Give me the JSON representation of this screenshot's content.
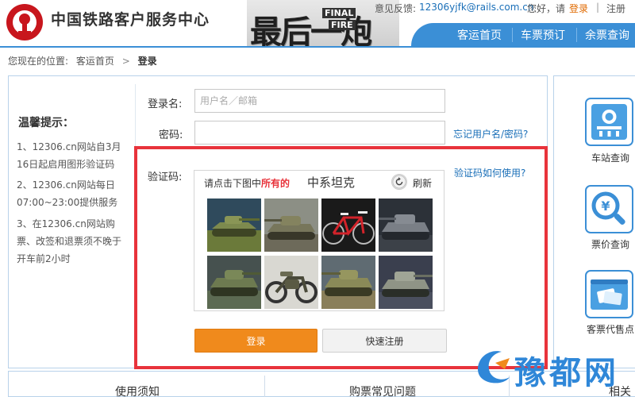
{
  "header": {
    "site_title": "中国铁路客户服务中心",
    "banner_title": "最后一炮",
    "banner_sub1": "FINAL",
    "banner_sub2": "FIRE",
    "feedback_label": "意见反馈:",
    "feedback_email": "12306yjfk@rails.com.cn",
    "greeting": "您好，请",
    "login_link": "登录",
    "separator": "|",
    "register_link": "注册",
    "nav": [
      "客运首页",
      "车票预订",
      "余票查询"
    ],
    "brand_color": "#3b8fd6"
  },
  "breadcrumb": {
    "prefix": "您现在的位置:",
    "home": "客运首页",
    "arrow": ">",
    "current": "登录"
  },
  "tips": {
    "title": "温馨提示：",
    "items": [
      "1、12306.cn网站自3月16日起启用图形验证码",
      "2、12306.cn网站每日07:00~23:00提供服务",
      "3、在12306.cn网站购票、改签和退票须不晚于开车前2小时"
    ]
  },
  "form": {
    "username_label": "登录名:",
    "username_placeholder": "用户名／邮箱",
    "password_label": "密码:",
    "forgot_link": "忘记用户名/密码?",
    "captcha_label": "验证码:",
    "captcha_help_link": "验证码如何使用?",
    "captcha_prompt_prefix": "请点击下图中",
    "captcha_prompt_emph": "所有的",
    "captcha_target": "中系坦克",
    "refresh_label": "刷新",
    "captcha_images": [
      "tank-image",
      "tank-image",
      "bicycle-image",
      "tank-image",
      "tank-image",
      "motorcycle-image",
      "tank-image",
      "tank-image"
    ],
    "login_button": "登录",
    "quick_register_button": "快速注册",
    "highlight_color": "#e8333b",
    "login_button_color": "#f08a1c"
  },
  "right_sidebar": {
    "items": [
      {
        "label": "车站查询",
        "icon": "station-icon"
      },
      {
        "label": "票价查询",
        "icon": "fare-search-icon"
      },
      {
        "label": "客票代售点",
        "icon": "ticket-agency-icon"
      }
    ]
  },
  "bottom_tabs": [
    "使用须知",
    "购票常见问题",
    "相关"
  ],
  "watermark": {
    "text": "豫都网"
  }
}
